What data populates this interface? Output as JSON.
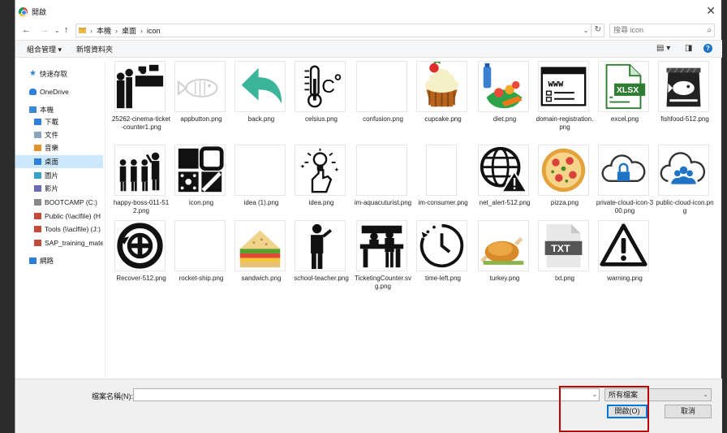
{
  "window": {
    "title": "開啟"
  },
  "address": {
    "crumbs": [
      "本機",
      "桌面",
      "icon"
    ],
    "search_placeholder": "搜尋 icon"
  },
  "toolbar": {
    "organize": "組合管理 ▾",
    "new_folder": "新增資料夾"
  },
  "sidebar": {
    "items": [
      {
        "label": "快速存取",
        "icon": "star-icon"
      },
      {
        "label": "OneDrive",
        "icon": "cloud-icon"
      },
      {
        "label": "本機",
        "icon": "computer-icon"
      },
      {
        "label": "下載",
        "icon": "download-icon"
      },
      {
        "label": "文件",
        "icon": "document-icon"
      },
      {
        "label": "音樂",
        "icon": "music-icon"
      },
      {
        "label": "桌面",
        "icon": "desktop-icon",
        "selected": true
      },
      {
        "label": "圖片",
        "icon": "picture-icon"
      },
      {
        "label": "影片",
        "icon": "video-icon"
      },
      {
        "label": "BOOTCAMP (C:)",
        "icon": "drive-icon"
      },
      {
        "label": "Public (\\\\aclfile) (H",
        "icon": "network-drive-icon"
      },
      {
        "label": "Tools (\\\\aclfile) (J:)",
        "icon": "network-drive-icon"
      },
      {
        "label": "SAP_training_mate",
        "icon": "network-drive-icon"
      },
      {
        "label": "網路",
        "icon": "network-icon"
      }
    ]
  },
  "files": [
    {
      "name": "25262-cinema-ticket-counter1.png",
      "icon": "cinema-counter"
    },
    {
      "name": "appbutton.png",
      "icon": "fish-outline"
    },
    {
      "name": "back.png",
      "icon": "back-arrow"
    },
    {
      "name": "celsius.png",
      "icon": "thermometer-celsius"
    },
    {
      "name": "confusion.png",
      "icon": "blank"
    },
    {
      "name": "cupcake.png",
      "icon": "cupcake"
    },
    {
      "name": "diet.png",
      "icon": "diet-food"
    },
    {
      "name": "domain-registration.png",
      "icon": "www-window"
    },
    {
      "name": "excel.png",
      "icon": "xlsx-file"
    },
    {
      "name": "fishfood-512.png",
      "icon": "fish-food-bag"
    },
    {
      "name": "happy-boss-011-512.png",
      "icon": "boss-team"
    },
    {
      "name": "icon.png",
      "icon": "icon-grid"
    },
    {
      "name": "idea (1).png",
      "icon": "blank"
    },
    {
      "name": "idea.png",
      "icon": "lightbulb-hand"
    },
    {
      "name": "im-aquacuturist.png",
      "icon": "blank"
    },
    {
      "name": "im-consumer.png",
      "icon": "blank-narrow"
    },
    {
      "name": "net_alert-512.png",
      "icon": "globe-alert"
    },
    {
      "name": "pizza.png",
      "icon": "pizza"
    },
    {
      "name": "private-cloud-icon-300.png",
      "icon": "cloud-lock"
    },
    {
      "name": "public-cloud-icon.png",
      "icon": "cloud-people"
    },
    {
      "name": "Recover-512.png",
      "icon": "recover"
    },
    {
      "name": "rocket-ship.png",
      "icon": "blank"
    },
    {
      "name": "sandwich.png",
      "icon": "sandwich"
    },
    {
      "name": "school-teacher.png",
      "icon": "teacher"
    },
    {
      "name": "TicketingCounter.svg.png",
      "icon": "ticket-counter"
    },
    {
      "name": "time-left.png",
      "icon": "clock"
    },
    {
      "name": "turkey.png",
      "icon": "turkey"
    },
    {
      "name": "txt.png",
      "icon": "txt-file"
    },
    {
      "name": "warning.png",
      "icon": "warning-triangle"
    }
  ],
  "footer": {
    "filename_label": "檔案名稱(N):",
    "filename_value": "",
    "filetype": "所有檔案",
    "open_label": "開啟(O)",
    "cancel_label": "取消"
  }
}
